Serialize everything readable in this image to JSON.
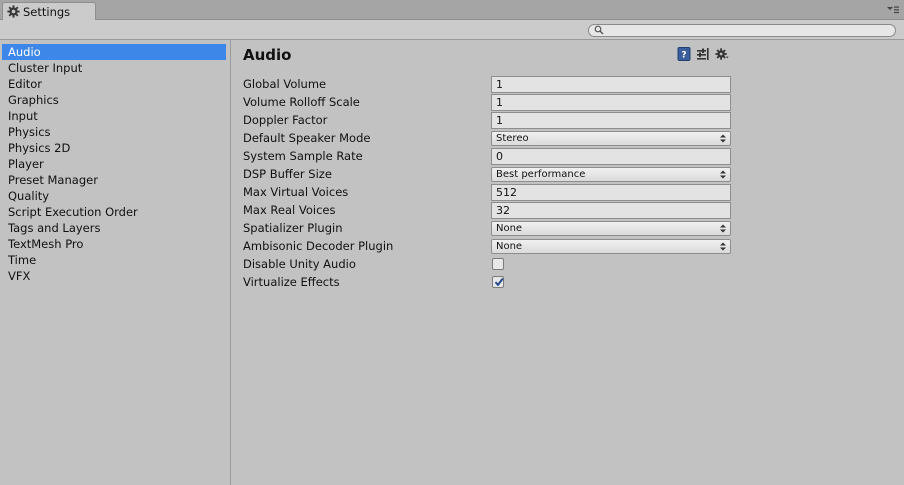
{
  "window": {
    "tab_title": "Settings"
  },
  "search": {
    "placeholder": ""
  },
  "sidebar": {
    "items": [
      {
        "label": "Audio",
        "selected": true
      },
      {
        "label": "Cluster Input"
      },
      {
        "label": "Editor"
      },
      {
        "label": "Graphics"
      },
      {
        "label": "Input"
      },
      {
        "label": "Physics"
      },
      {
        "label": "Physics 2D"
      },
      {
        "label": "Player"
      },
      {
        "label": "Preset Manager"
      },
      {
        "label": "Quality"
      },
      {
        "label": "Script Execution Order"
      },
      {
        "label": "Tags and Layers"
      },
      {
        "label": "TextMesh Pro"
      },
      {
        "label": "Time"
      },
      {
        "label": "VFX"
      }
    ]
  },
  "main": {
    "title": "Audio",
    "header_icons": [
      "help-book-icon",
      "preset-sliders-icon",
      "settings-gear-icon"
    ],
    "fields": {
      "global_volume": {
        "label": "Global Volume",
        "value": "1"
      },
      "volume_rolloff_scale": {
        "label": "Volume Rolloff Scale",
        "value": "1"
      },
      "doppler_factor": {
        "label": "Doppler Factor",
        "value": "1"
      },
      "default_speaker_mode": {
        "label": "Default Speaker Mode",
        "value": "Stereo"
      },
      "system_sample_rate": {
        "label": "System Sample Rate",
        "value": "0"
      },
      "dsp_buffer_size": {
        "label": "DSP Buffer Size",
        "value": "Best performance"
      },
      "max_virtual_voices": {
        "label": "Max Virtual Voices",
        "value": "512"
      },
      "max_real_voices": {
        "label": "Max Real Voices",
        "value": "32"
      },
      "spatializer_plugin": {
        "label": "Spatializer Plugin",
        "value": "None"
      },
      "ambisonic_decoder_plugin": {
        "label": "Ambisonic Decoder Plugin",
        "value": "None"
      },
      "disable_unity_audio": {
        "label": "Disable Unity Audio",
        "checked": false
      },
      "virtualize_effects": {
        "label": "Virtualize Effects",
        "checked": true
      }
    }
  },
  "colors": {
    "selection": "#3d87e8",
    "panel_bg": "#c2c2c2",
    "field_bg": "#e3e3e3"
  }
}
